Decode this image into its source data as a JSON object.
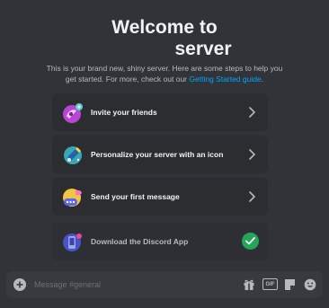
{
  "welcome": {
    "title_line1": "Welcome to",
    "title_line2": "server",
    "subtitle": "This is your brand new, shiny server. Here are some steps to help you get started. For more, check out our",
    "link": "Getting Started guide",
    "period": "."
  },
  "cards": [
    {
      "label": "Invite your friends",
      "icon": "invite-friends-icon",
      "state": "todo"
    },
    {
      "label": "Personalize your server with an icon",
      "icon": "personalize-server-icon",
      "state": "todo"
    },
    {
      "label": "Send your first message",
      "icon": "send-message-icon",
      "state": "todo"
    },
    {
      "label": "Download the Discord App",
      "icon": "download-app-icon",
      "state": "done"
    }
  ],
  "composer": {
    "placeholder": "Message #general",
    "gif_label": "GIF"
  },
  "colors": {
    "background": "#313338",
    "card": "#2b2d31",
    "link": "#00a8fc",
    "success": "#23a55a"
  }
}
